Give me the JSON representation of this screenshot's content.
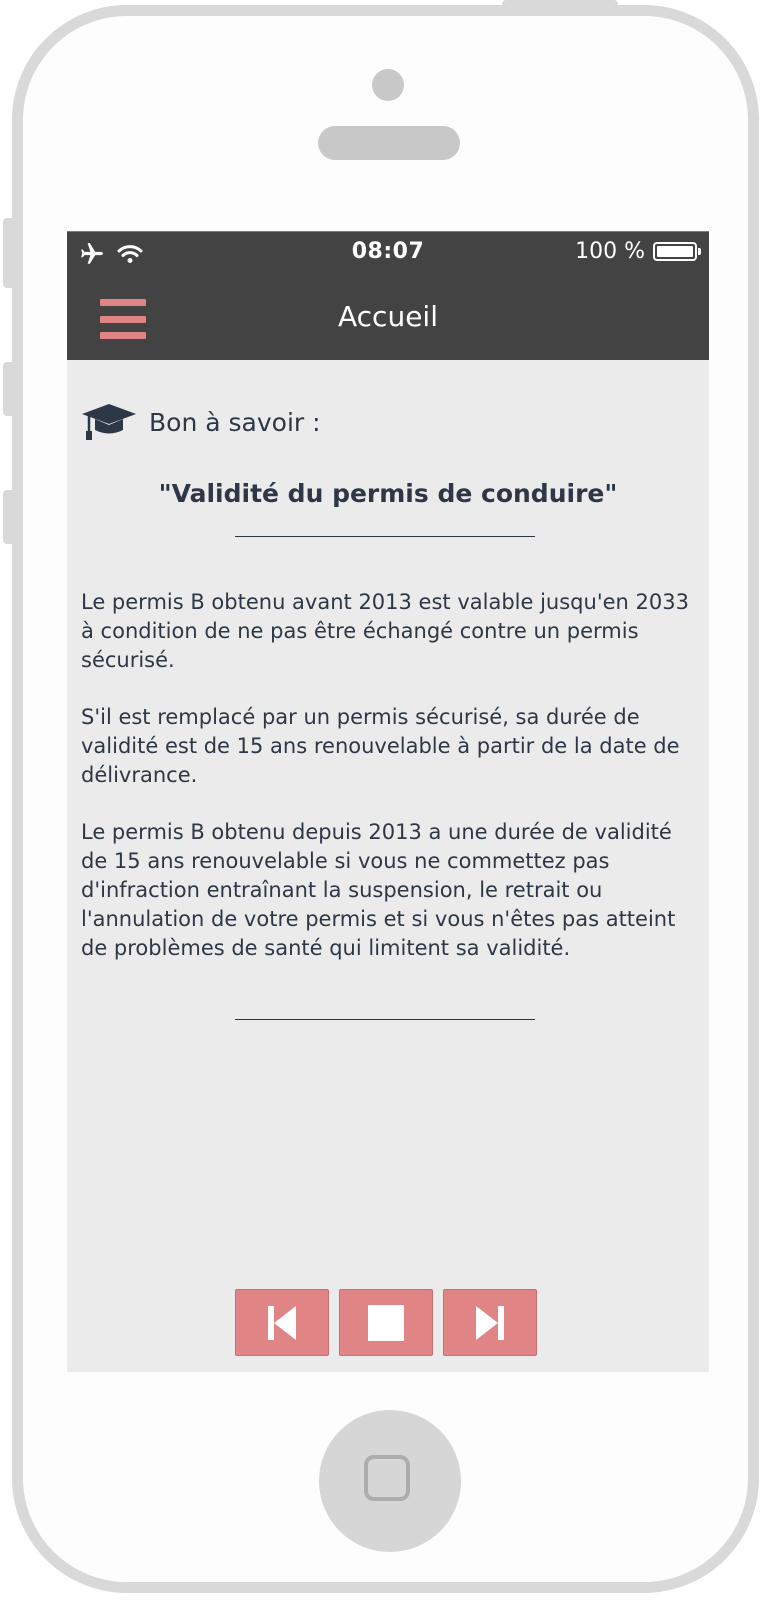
{
  "status_bar": {
    "time": "08:07",
    "battery": "100 %",
    "icons": [
      "airplane-icon",
      "wifi-icon",
      "battery-icon"
    ]
  },
  "header": {
    "title": "Accueil",
    "menu_icon": "hamburger-menu-icon"
  },
  "content": {
    "section_label": "Bon à savoir :",
    "section_icon": "graduation-cap-icon",
    "title": "\"Validité du permis de conduire\"",
    "paragraphs": [
      "Le permis B obtenu avant 2013 est valable jusqu'en 2033 à condition de ne pas être échangé contre un permis sécurisé.",
      "S'il est remplacé par un permis sécurisé, sa durée de validité est de 15 ans renouvelable à partir de la date de délivrance.",
      "Le permis B obtenu depuis 2013 a une durée de validité de 15 ans renouvelable si vous ne commettez pas d'infraction entraînant la suspension, le retrait ou l'annulation de votre permis et si vous n'êtes pas atteint de problèmes de santé qui limitent sa validité."
    ]
  },
  "controls": {
    "icons": [
      "skip-previous-icon",
      "stop-icon",
      "skip-next-icon"
    ]
  },
  "colors": {
    "accent": "#e08486",
    "header_bg": "#434343",
    "content_bg": "#ebebeb",
    "text": "#2d3746"
  }
}
